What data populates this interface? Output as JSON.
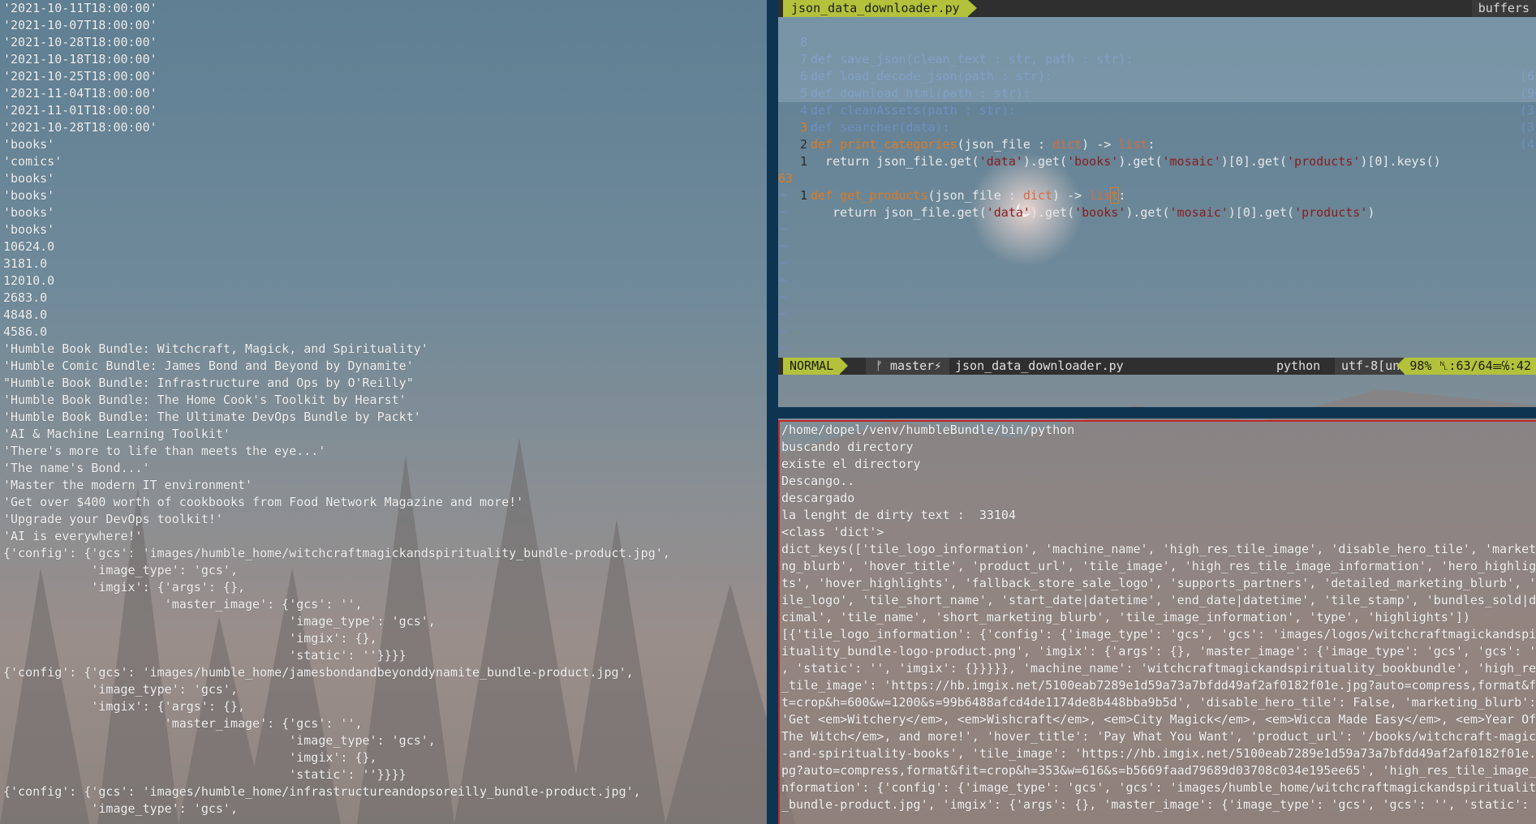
{
  "left_output": {
    "lines": [
      "'2021-10-11T18:00:00'",
      "'2021-10-07T18:00:00'",
      "'2021-10-28T18:00:00'",
      "'2021-10-18T18:00:00'",
      "'2021-10-25T18:00:00'",
      "'2021-11-04T18:00:00'",
      "'2021-11-01T18:00:00'",
      "'2021-10-28T18:00:00'",
      "'books'",
      "'comics'",
      "'books'",
      "'books'",
      "'books'",
      "'books'",
      "10624.0",
      "3181.0",
      "12010.0",
      "2683.0",
      "4848.0",
      "4586.0",
      "'Humble Book Bundle: Witchcraft, Magick, and Spirituality'",
      "'Humble Comic Bundle: James Bond and Beyond by Dynamite'",
      "\"Humble Book Bundle: Infrastructure and Ops by O'Reilly\"",
      "'Humble Book Bundle: The Home Cook's Toolkit by Hearst'",
      "'Humble Book Bundle: The Ultimate DevOps Bundle by Packt'",
      "'AI & Machine Learning Toolkit'",
      "'There's more to life than meets the eye...'",
      "'The name's Bond...'",
      "'Master the modern IT environment'",
      "'Get over $400 worth of cookbooks from Food Network Magazine and more!'",
      "'Upgrade your DevOps toolkit!'",
      "'AI is everywhere!'",
      "{'config': {'gcs': 'images/humble_home/witchcraftmagickandspirituality_bundle-product.jpg',",
      "            'image_type': 'gcs',",
      "            'imgix': {'args': {},",
      "                      'master_image': {'gcs': '',",
      "                                       'image_type': 'gcs',",
      "                                       'imgix': {},",
      "                                       'static': ''}}}}",
      "{'config': {'gcs': 'images/humble_home/jamesbondandbeyonddynamite_bundle-product.jpg',",
      "            'image_type': 'gcs',",
      "            'imgix': {'args': {},",
      "                      'master_image': {'gcs': '',",
      "                                       'image_type': 'gcs',",
      "                                       'imgix': {},",
      "                                       'static': ''}}}}",
      "{'config': {'gcs': 'images/humble_home/infrastructureandopsoreilly_bundle-product.jpg',",
      "            'image_type': 'gcs',"
    ]
  },
  "editor": {
    "tab_title": "json_data_downloader.py",
    "tab_right": "buffers",
    "lines": [
      {
        "num": "8",
        "text": "def save_json(clean_text : str, path : str):",
        "right": "(6"
      },
      {
        "num": "7",
        "text": "def load_decode_json(path : str):",
        "right": "(9"
      },
      {
        "num": "6",
        "text": "def download_html(path : str):",
        "right": "(3"
      },
      {
        "num": "5",
        "text": "def cleanAssets(path : str):",
        "right": "(3"
      },
      {
        "num": "4",
        "text": "def searcher(data):",
        "right": "(4"
      }
    ],
    "line3": {
      "num": "3",
      "kw": "def ",
      "fn": "print_categories",
      "p1": "(json_file : ",
      "ty1": "dict",
      "p2": ") -> ",
      "ty2": "list",
      "p3": ":"
    },
    "line2": {
      "num": "2",
      "a": "  return json_file.get(",
      "s1": "'data'",
      "b": ").get(",
      "s2": "'books'",
      "c": ").get(",
      "s3": "'mosaic'",
      "d": ")[0].get(",
      "s4": "'products'",
      "e": ")[0].keys()"
    },
    "line1a": {
      "num": "1"
    },
    "line63": {
      "num": "63",
      "kw": "def ",
      "fn": "get_products",
      "p1": "(json_file : ",
      "ty1": "dict",
      "p2": ") -> ",
      "ty2a": "lis",
      "cur": "t",
      "p3": ":"
    },
    "line1b": {
      "num": "1",
      "a": "   return json_file.get(",
      "s1": "'data'",
      "b": ").get(",
      "s2": "'books'",
      "c": ").get(",
      "s3": "'mosaic'",
      "d": ")[0].get(",
      "s4": "'products'",
      "e": ")"
    },
    "tilde": "~"
  },
  "statusline": {
    "mode": "NORMAL",
    "branch": "ᚠ master⚡",
    "file": "json_data_downloader.py",
    "filetype": "python",
    "encoding": "utf-8[unix]",
    "position": "98% ␤:63/64☰℅:42"
  },
  "terminal": {
    "lines": [
      "/home/dopel/venv/humbleBundle/bin/python",
      "buscando directory",
      "existe el directory",
      "Descango..",
      "descargado",
      "la lenght de dirty text :  33104",
      "<class 'dict'>",
      "dict_keys(['tile_logo_information', 'machine_name', 'high_res_tile_image', 'disable_hero_tile', 'market",
      "ng_blurb', 'hover_title', 'product_url', 'tile_image', 'high_res_tile_image_information', 'hero_highlig",
      "ts', 'hover_highlights', 'fallback_store_sale_logo', 'supports_partners', 'detailed_marketing_blurb', '",
      "ile_logo', 'tile_short_name', 'start_date|datetime', 'end_date|datetime', 'tile_stamp', 'bundles_sold|de",
      "cimal', 'tile_name', 'short_marketing_blurb', 'tile_image_information', 'type', 'highlights'])",
      "[{'tile_logo_information': {'config': {'image_type': 'gcs', 'gcs': 'images/logos/witchcraftmagickandspi",
      "ituality_bundle-logo-product.png', 'imgix': {'args': {}, 'master_image': {'image_type': 'gcs', 'gcs': '",
      ", 'static': '', 'imgix': {}}}}}, 'machine_name': 'witchcraftmagickandspirituality_bookbundle', 'high_re",
      "_tile_image': 'https://hb.imgix.net/5100eab7289e1d59a73a7bfdd49af2af0182f01e.jpg?auto=compress,format&f",
      "t=crop&h=600&w=1200&s=99b6488afcd4de1174de8b448bba9b5d', 'disable_hero_tile': False, 'marketing_blurb':",
      "'Get <em>Witchery</em>, <em>Wishcraft</em>, <em>City Magick</em>, <em>Wicca Made Easy</em>, <em>Year Of",
      "The Witch</em>, and more!', 'hover_title': 'Pay What You Want', 'product_url': '/books/witchcraft-magic",
      "-and-spirituality-books', 'tile_image': 'https://hb.imgix.net/5100eab7289e1d59a73a7bfdd49af2af0182f01e.",
      "pg?auto=compress,format&fit=crop&h=353&w=616&s=b5669faad79689d03708c034e195ee65', 'high_res_tile_image_",
      "nformation': {'config': {'image_type': 'gcs', 'gcs': 'images/humble_home/witchcraftmagickandspiritualit",
      "_bundle-product.jpg', 'imgix': {'args': {}, 'master_image': {'image_type': 'gcs', 'gcs': '', 'static':"
    ]
  }
}
